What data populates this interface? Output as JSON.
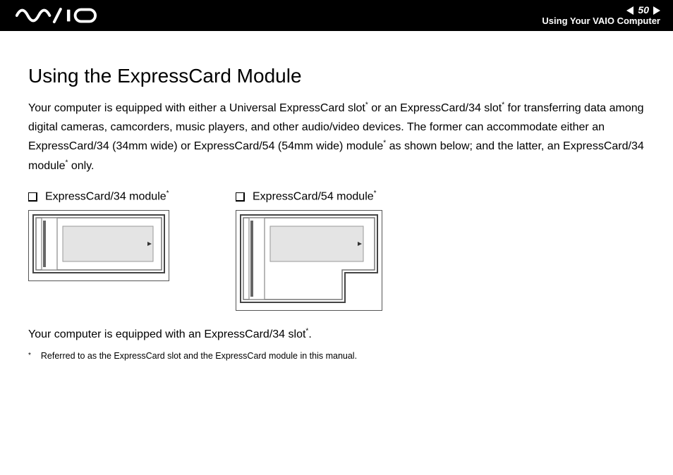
{
  "header": {
    "page_number": "50",
    "section": "Using Your VAIO Computer",
    "logo_alt": "VAIO"
  },
  "title": "Using the ExpressCard Module",
  "paragraph_parts": {
    "p1a": "Your computer is equipped with either a Universal ExpressCard slot",
    "p1b": " or an ExpressCard/34 slot",
    "p1c": " for transferring data among digital cameras, camcorders, music players, and other audio/video devices. The former can accommodate either an ExpressCard/34 (34mm wide) or ExpressCard/54 (54mm wide) module",
    "p1d": " as shown below; and the latter, an ExpressCard/34 module",
    "p1e": " only."
  },
  "modules": {
    "m34_label": "ExpressCard/34 module",
    "m54_label": "ExpressCard/54 module"
  },
  "footer_sentence_a": "Your computer is equipped with an ExpressCard/34 slot",
  "footer_sentence_b": ".",
  "footnote_marker": "*",
  "footnote_text": "Referred to as the ExpressCard slot and the ExpressCard module in this manual.",
  "asterisk": "*"
}
